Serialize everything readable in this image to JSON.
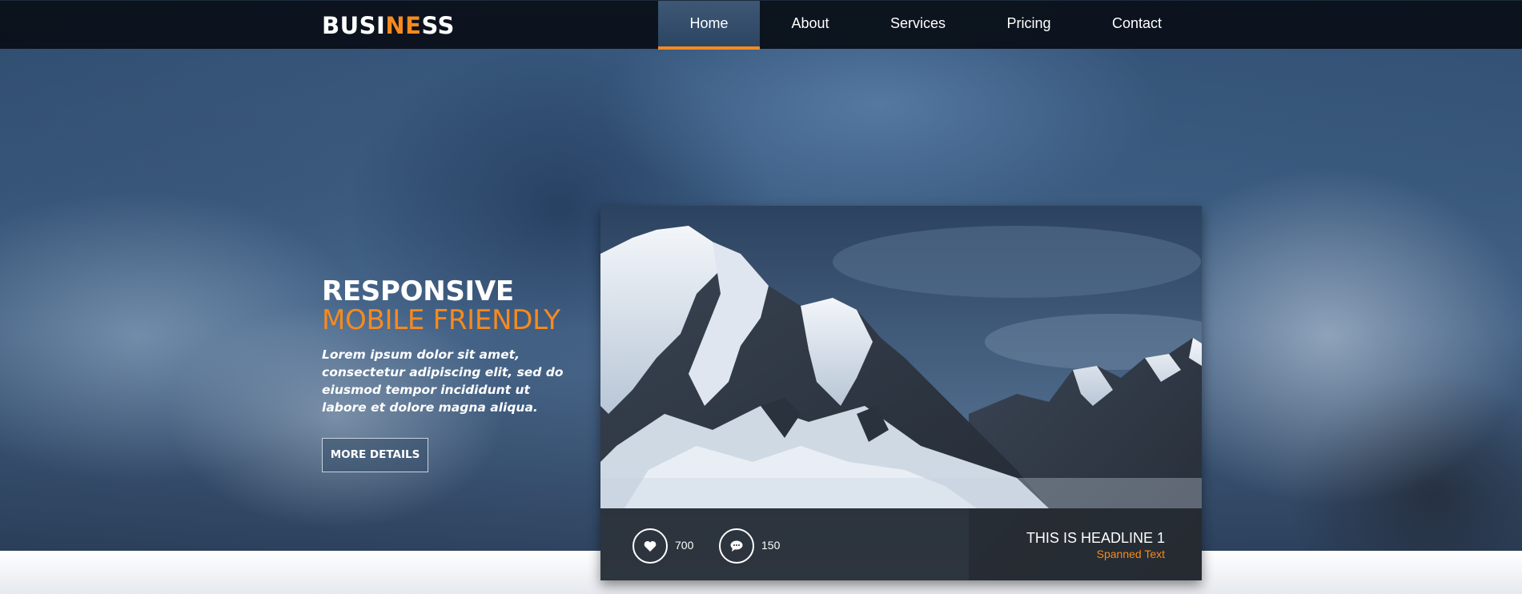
{
  "brand": {
    "logo_part1": "BUSI",
    "logo_highlight": "NE",
    "logo_part2": "SS"
  },
  "nav": {
    "items": [
      {
        "label": "Home",
        "active": true
      },
      {
        "label": "About",
        "active": false
      },
      {
        "label": "Services",
        "active": false
      },
      {
        "label": "Pricing",
        "active": false
      },
      {
        "label": "Contact",
        "active": false
      }
    ]
  },
  "hero": {
    "title_line1": "RESPONSIVE",
    "title_line2": "MOBILE FRIENDLY",
    "body": "Lorem ipsum dolor sit amet, consectetur adipiscing elit, sed do eiusmod tempor incididunt ut labore et dolore magna aliqua.",
    "button_label": "MORE DETAILS"
  },
  "card": {
    "likes_icon": "heart-icon",
    "likes": "700",
    "comments_icon": "speech-bubble-icon",
    "comments": "150",
    "headline": "THIS IS HEADLINE 1",
    "subtext": "Spanned Text"
  },
  "colors": {
    "accent": "#f68a1f",
    "navbar": "#0b1119",
    "active_nav": "#35506e",
    "caption_bg": "#1c2026"
  }
}
